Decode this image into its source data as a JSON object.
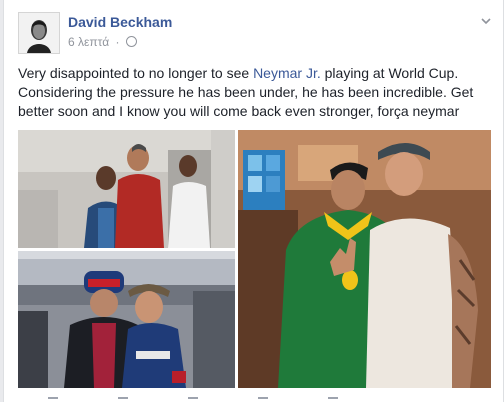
{
  "post": {
    "author": "David Beckham",
    "time": "6 λεπτά",
    "separator": "·",
    "text_before_link": "Very disappointed to no longer to see ",
    "mention": "Neymar Jr.",
    "text_after_link": " playing at World Cup. Considering the pressure he has been under, he has been incredible. Get better soon and I know you will come back even stronger, força neymar"
  },
  "icons": {
    "privacy": "globe-icon",
    "menu": "chevron-down-icon",
    "avatar": "profile-photo"
  },
  "photos": [
    {
      "name": "photo-top-left-room"
    },
    {
      "name": "photo-bottom-left-redbull"
    },
    {
      "name": "photo-right-brazil-jersey"
    }
  ],
  "colors": {
    "link": "#3b5998",
    "text": "#1d2129",
    "meta": "#90949c"
  }
}
